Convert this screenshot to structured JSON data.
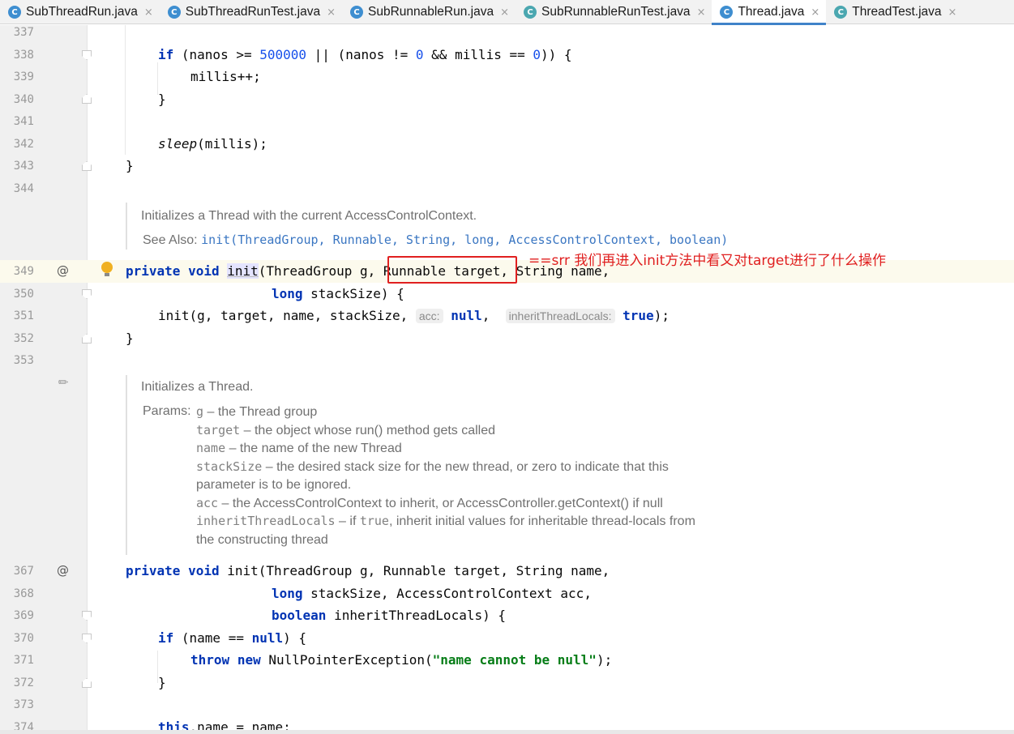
{
  "tabs": [
    {
      "label": "SubThreadRun.java",
      "active": false,
      "icon": "class-icon"
    },
    {
      "label": "SubThreadRunTest.java",
      "active": false,
      "icon": "class-icon"
    },
    {
      "label": "SubRunnableRun.java",
      "active": false,
      "icon": "class-icon"
    },
    {
      "label": "SubRunnableRunTest.java",
      "active": false,
      "icon": "runnable-class-icon"
    },
    {
      "label": "Thread.java",
      "active": true,
      "icon": "class-icon"
    },
    {
      "label": "ThreadTest.java",
      "active": false,
      "icon": "runnable-class-icon"
    }
  ],
  "tab_close_glyph": "×",
  "tab_icon_letter": "C",
  "gutter": {
    "line_numbers": {
      "l337": "337",
      "l338": "338",
      "l339": "339",
      "l340": "340",
      "l341": "341",
      "l342": "342",
      "l343": "343",
      "l344": "344",
      "l349": "349",
      "l350": "350",
      "l351": "351",
      "l352": "352",
      "l353": "353",
      "l367": "367",
      "l368": "368",
      "l369": "369",
      "l370": "370",
      "l371": "371",
      "l372": "372",
      "l373": "373",
      "l374": "374"
    },
    "override_marker": "@"
  },
  "code": {
    "if_kw": "if",
    "l338_a": " (nanos >= ",
    "l338_num1": "500000",
    "l338_b": " || (nanos != ",
    "l338_num2": "0",
    "l338_c": " && millis == ",
    "l338_num3": "0",
    "l338_d": ")) {",
    "l339": "millis++;",
    "brace_close": "}",
    "l342_sleep": "sleep",
    "l342_rest": "(millis);",
    "private_kw": "private",
    "void_kw": "void",
    "init_name": "init",
    "l349_rest_a": "(ThreadGroup g, ",
    "l349_target": "Runnable target",
    "l349_rest_b": ", String name,",
    "long_kw": "long",
    "l350_rest": " stackSize) {",
    "l351_a": "init(g, target, name, stackSize, ",
    "hint_acc": "acc:",
    "null_kw": "null",
    "l351_comma": ", ",
    "hint_inherit": "inheritThreadLocals:",
    "true_kw": "true",
    "l351_end": ");",
    "l367_rest": "(ThreadGroup g, Runnable target, String name,",
    "l368_rest": " stackSize, AccessControlContext acc,",
    "boolean_kw": "boolean",
    "l369_rest": " inheritThreadLocals) {",
    "l370_a": " (name == ",
    "l370_b": ") {",
    "throw_kw": "throw",
    "new_kw": "new",
    "l371_a": " NullPointerException(",
    "l371_str": "\"name cannot be null\"",
    "l371_b": ");",
    "this_kw": "this",
    "l374_rest": ".name = name;"
  },
  "doc1": {
    "summary": "Initializes a Thread with the current AccessControlContext.",
    "see_also_label": "See Also:",
    "see_also_link": "init(ThreadGroup, Runnable, String, long, AccessControlContext, boolean)"
  },
  "doc2": {
    "summary": "Initializes a Thread.",
    "params_label": "Params:",
    "params": [
      {
        "name": "g",
        "desc": " – the Thread group"
      },
      {
        "name": "target",
        "desc": " – the object whose run() method gets called"
      },
      {
        "name": "name",
        "desc": " – the name of the new Thread"
      },
      {
        "name": "stackSize",
        "desc": " – the desired stack size for the new thread, or zero to indicate that this"
      },
      {
        "name": "",
        "desc": "parameter is to be ignored."
      },
      {
        "name": "acc",
        "desc": " – the AccessControlContext to inherit, or AccessController.getContext() if null"
      },
      {
        "name": "inheritThreadLocals",
        "desc": " – if ",
        "mono2": "true",
        "desc2": ", inherit initial values for inheritable thread-locals from"
      },
      {
        "name": "",
        "desc": "the constructing thread"
      }
    ]
  },
  "annotation": {
    "text": "==srr  我们再进入init方法中看又对target进行了什么操作",
    "color": "#e02020"
  },
  "colors": {
    "keyword": "#0033b3",
    "number": "#1750eb",
    "string": "#067d17",
    "active_tab_underline": "#4083c9",
    "current_line": "#fcfaed"
  }
}
